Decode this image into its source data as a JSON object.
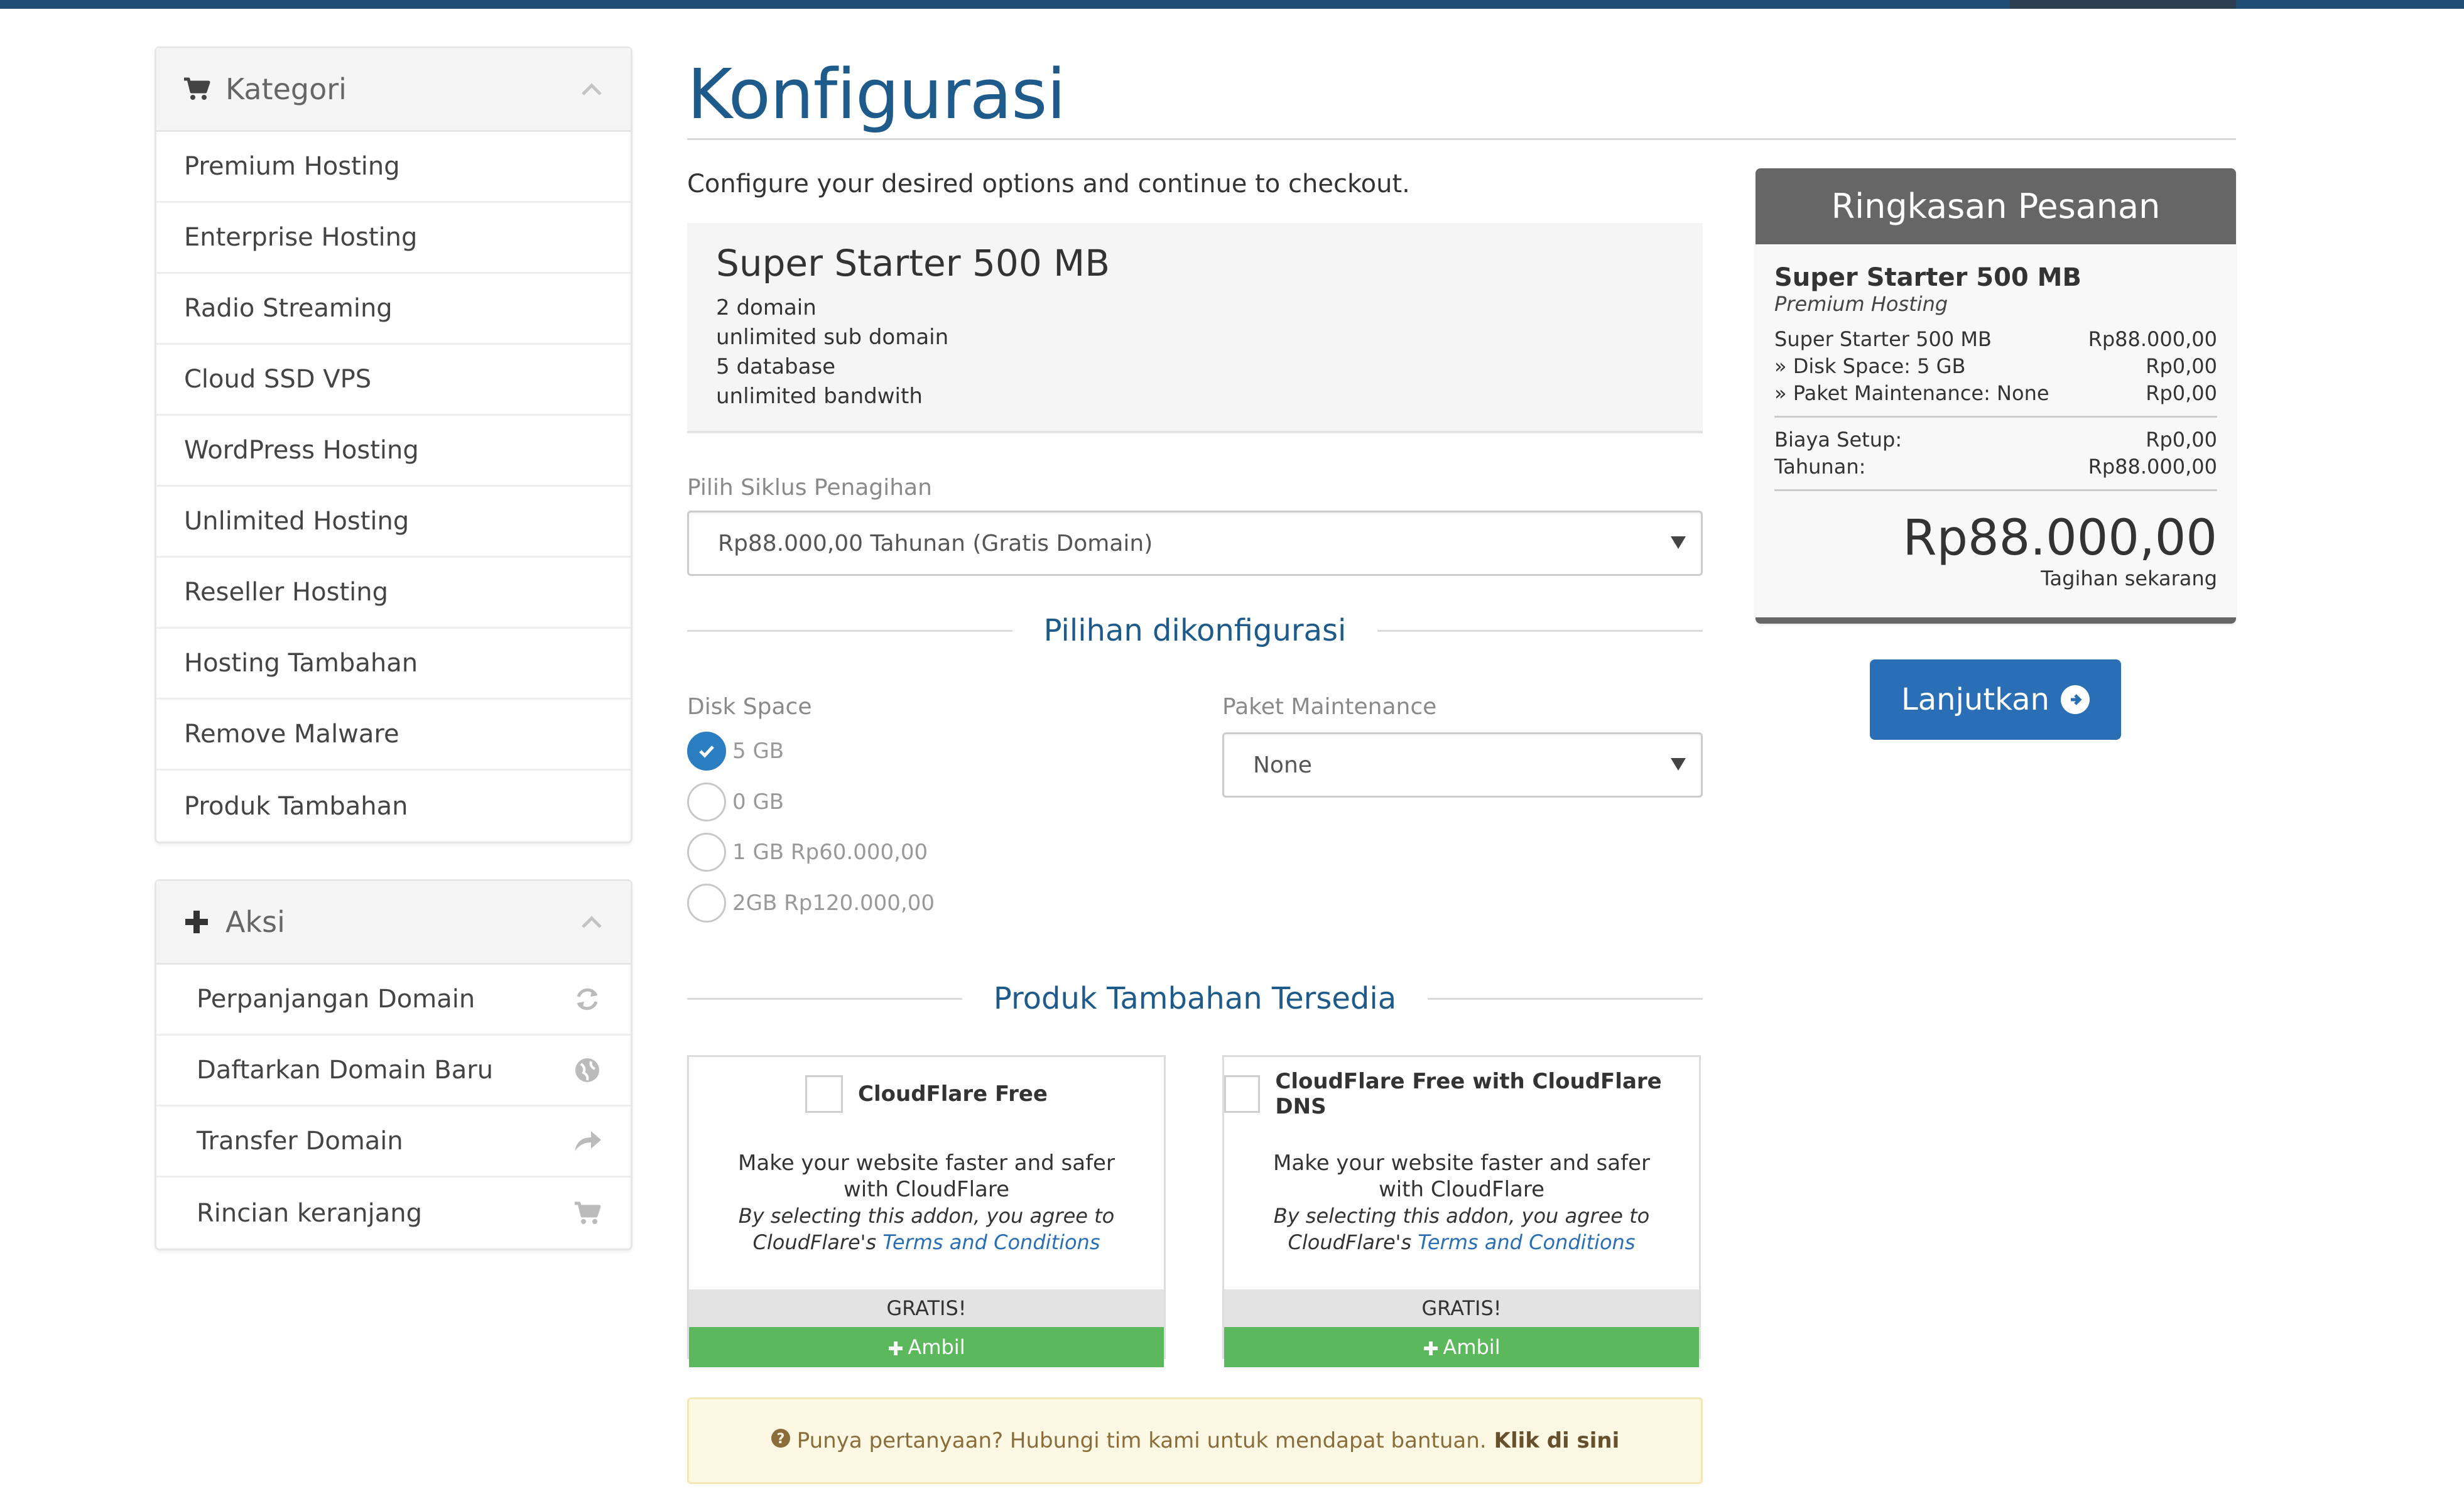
{
  "sidebar": {
    "category": {
      "title": "Kategori",
      "items": [
        "Premium Hosting",
        "Enterprise Hosting",
        "Radio Streaming",
        "Cloud SSD VPS",
        "WordPress Hosting",
        "Unlimited Hosting",
        "Reseller Hosting",
        "Hosting Tambahan",
        "Remove Malware",
        "Produk Tambahan"
      ]
    },
    "actions": {
      "title": "Aksi",
      "items": [
        {
          "label": "Perpanjangan Domain",
          "icon": "refresh-icon"
        },
        {
          "label": "Daftarkan Domain Baru",
          "icon": "globe-icon"
        },
        {
          "label": "Transfer Domain",
          "icon": "share-icon"
        },
        {
          "label": "Rincian keranjang",
          "icon": "cart-icon"
        }
      ]
    }
  },
  "main": {
    "title": "Konfigurasi",
    "subtitle": "Configure your desired options and continue to checkout.",
    "product": {
      "name": "Super Starter 500 MB",
      "features": [
        "2 domain",
        "unlimited sub domain",
        "5 database",
        "unlimited bandwith"
      ]
    },
    "billing": {
      "label": "Pilih Siklus Penagihan",
      "selected": "Rp88.000,00 Tahunan (Gratis Domain)"
    },
    "config": {
      "heading": "Pilihan dikonfigurasi",
      "disk": {
        "label": "Disk Space",
        "options": [
          {
            "label": "5 GB",
            "selected": true
          },
          {
            "label": "0 GB",
            "selected": false
          },
          {
            "label": "1 GB Rp60.000,00",
            "selected": false
          },
          {
            "label": "2GB Rp120.000,00",
            "selected": false
          }
        ]
      },
      "maintenance": {
        "label": "Paket Maintenance",
        "selected": "None"
      }
    },
    "addons": {
      "heading": "Produk Tambahan Tersedia",
      "items": [
        {
          "name": "CloudFlare Free",
          "desc": "Make your website faster and safer with CloudFlare",
          "agree_prefix": "By selecting this addon, you agree to CloudFlare's",
          "link": "Terms and Conditions",
          "price": "GRATIS!",
          "button": "Ambil"
        },
        {
          "name": "CloudFlare Free with CloudFlare DNS",
          "desc": "Make your website faster and safer with CloudFlare",
          "agree_prefix": "By selecting this addon, you agree to CloudFlare's",
          "link": "Terms and Conditions",
          "price": "GRATIS!",
          "button": "Ambil"
        }
      ]
    },
    "help": {
      "text": "Punya pertanyaan? Hubungi tim kami untuk mendapat bantuan.",
      "link": "Klik di sini"
    }
  },
  "summary": {
    "title": "Ringkasan Pesanan",
    "product": "Super Starter 500 MB",
    "category": "Premium Hosting",
    "lines": [
      {
        "label": "Super Starter 500 MB",
        "value": "Rp88.000,00"
      },
      {
        "label": "» Disk Space: 5 GB",
        "value": "Rp0,00"
      },
      {
        "label": "» Paket Maintenance: None",
        "value": "Rp0,00"
      }
    ],
    "fees": [
      {
        "label": "Biaya Setup:",
        "value": "Rp0,00"
      },
      {
        "label": "Tahunan:",
        "value": "Rp88.000,00"
      }
    ],
    "total": "Rp88.000,00",
    "total_label": "Tagihan sekarang",
    "button": "Lanjutkan"
  },
  "colors": {
    "primary": "#1e5b8a",
    "button": "#2a6fb5",
    "success": "#5cb85c",
    "summary_header": "#666666",
    "topbar": "#1f4d74"
  }
}
